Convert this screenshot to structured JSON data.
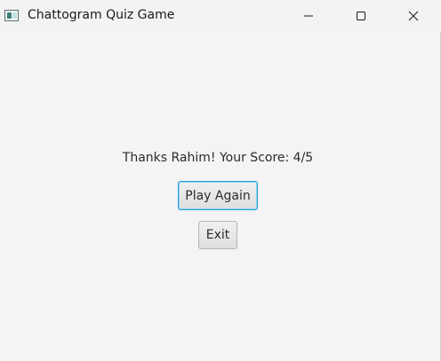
{
  "window": {
    "title": "Chattogram Quiz Game",
    "icon": "java-app-icon"
  },
  "caption_buttons": {
    "minimize_icon": "minimize-icon",
    "maximize_icon": "maximize-icon",
    "close_icon": "close-icon"
  },
  "result": {
    "message": "Thanks Rahim! Your Score: 4/5"
  },
  "actions": {
    "play_again_label": "Play Again",
    "exit_label": "Exit"
  },
  "colors": {
    "focus_border": "#2a9fd6",
    "background": "#f4f4f4"
  }
}
